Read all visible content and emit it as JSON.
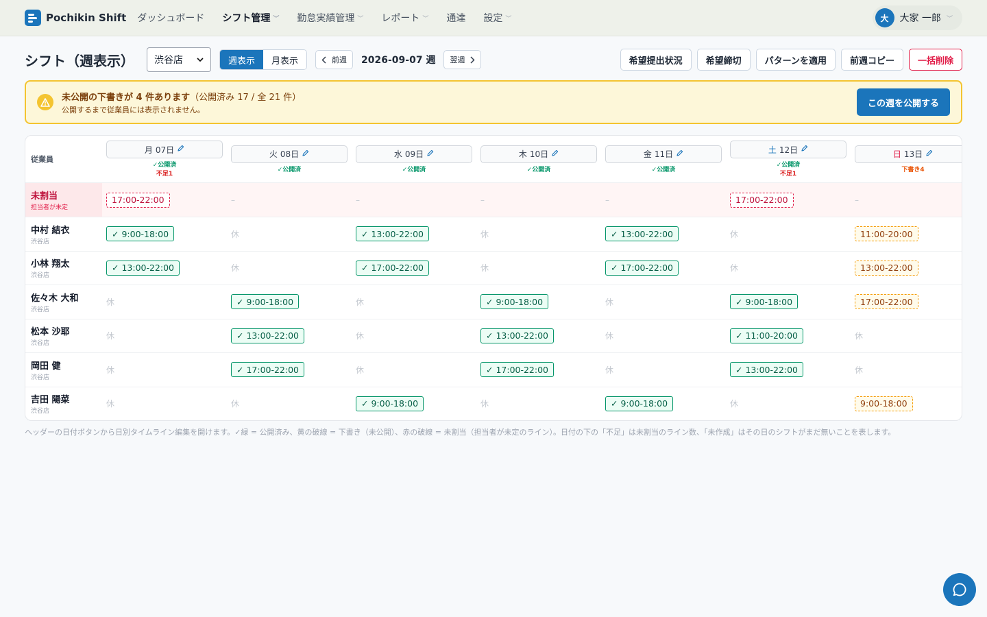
{
  "brand": {
    "name": "Pochikin Shift"
  },
  "nav": {
    "items": [
      {
        "label": "ダッシュボード",
        "dropdown": false
      },
      {
        "label": "シフト管理",
        "dropdown": true,
        "active": true
      },
      {
        "label": "勤怠実績管理",
        "dropdown": true
      },
      {
        "label": "レポート",
        "dropdown": true
      },
      {
        "label": "通達",
        "dropdown": false
      },
      {
        "label": "設定",
        "dropdown": true
      }
    ]
  },
  "user": {
    "initial": "大",
    "name": "大家 一郎"
  },
  "toolbar": {
    "title": "シフト（週表示）",
    "store": "渋谷店",
    "view_week": "週表示",
    "view_month": "月表示",
    "prev": "前週",
    "week_label": "2026-09-07 週",
    "next": "翌週",
    "actions": [
      "希望提出状況",
      "希望締切",
      "パターンを適用",
      "前週コピー",
      "一括削除"
    ]
  },
  "banner": {
    "headline": "未公開の下書きが 4 件あります",
    "counts": "（公開済み 17 / 全 21 件）",
    "note": "公開するまで従業員には表示されません。",
    "publish": "この週を公開する"
  },
  "table": {
    "employee_header": "従業員",
    "days": [
      {
        "weekday": "月",
        "date": "07日",
        "status": "✓公開済",
        "lack": "不足1",
        "kind": "weekday"
      },
      {
        "weekday": "火",
        "date": "08日",
        "status": "✓公開済",
        "lack": "",
        "kind": "weekday"
      },
      {
        "weekday": "水",
        "date": "09日",
        "status": "✓公開済",
        "lack": "",
        "kind": "weekday"
      },
      {
        "weekday": "木",
        "date": "10日",
        "status": "✓公開済",
        "lack": "",
        "kind": "weekday"
      },
      {
        "weekday": "金",
        "date": "11日",
        "status": "✓公開済",
        "lack": "",
        "kind": "weekday"
      },
      {
        "weekday": "土",
        "date": "12日",
        "status": "✓公開済",
        "lack": "不足1",
        "kind": "sat"
      },
      {
        "weekday": "日",
        "date": "13日",
        "status": "下書き4",
        "lack": "",
        "kind": "sun"
      }
    ],
    "unassigned": {
      "name": "未割当",
      "sub": "担当者が未定",
      "cells": [
        "17:00-22:00",
        "–",
        "–",
        "–",
        "–",
        "17:00-22:00",
        "–"
      ]
    },
    "employees": [
      {
        "name": "中村 結衣",
        "store": "渋谷店",
        "cells": [
          {
            "t": "pub",
            "v": "✓ 9:00-18:00"
          },
          {
            "t": "off",
            "v": "休"
          },
          {
            "t": "pub",
            "v": "✓ 13:00-22:00"
          },
          {
            "t": "off",
            "v": "休"
          },
          {
            "t": "pub",
            "v": "✓ 13:00-22:00"
          },
          {
            "t": "off",
            "v": "休"
          },
          {
            "t": "draft",
            "v": "11:00-20:00"
          }
        ]
      },
      {
        "name": "小林 翔太",
        "store": "渋谷店",
        "cells": [
          {
            "t": "pub",
            "v": "✓ 13:00-22:00"
          },
          {
            "t": "off",
            "v": "休"
          },
          {
            "t": "pub",
            "v": "✓ 17:00-22:00"
          },
          {
            "t": "off",
            "v": "休"
          },
          {
            "t": "pub",
            "v": "✓ 17:00-22:00"
          },
          {
            "t": "off",
            "v": "休"
          },
          {
            "t": "draft",
            "v": "13:00-22:00"
          }
        ]
      },
      {
        "name": "佐々木 大和",
        "store": "渋谷店",
        "cells": [
          {
            "t": "off",
            "v": "休"
          },
          {
            "t": "pub",
            "v": "✓ 9:00-18:00"
          },
          {
            "t": "off",
            "v": "休"
          },
          {
            "t": "pub",
            "v": "✓ 9:00-18:00"
          },
          {
            "t": "off",
            "v": "休"
          },
          {
            "t": "pub",
            "v": "✓ 9:00-18:00"
          },
          {
            "t": "draft",
            "v": "17:00-22:00"
          }
        ]
      },
      {
        "name": "松本 沙耶",
        "store": "渋谷店",
        "cells": [
          {
            "t": "off",
            "v": "休"
          },
          {
            "t": "pub",
            "v": "✓ 13:00-22:00"
          },
          {
            "t": "off",
            "v": "休"
          },
          {
            "t": "pub",
            "v": "✓ 13:00-22:00"
          },
          {
            "t": "off",
            "v": "休"
          },
          {
            "t": "pub",
            "v": "✓ 11:00-20:00"
          },
          {
            "t": "off",
            "v": "休"
          }
        ]
      },
      {
        "name": "岡田 健",
        "store": "渋谷店",
        "cells": [
          {
            "t": "off",
            "v": "休"
          },
          {
            "t": "pub",
            "v": "✓ 17:00-22:00"
          },
          {
            "t": "off",
            "v": "休"
          },
          {
            "t": "pub",
            "v": "✓ 17:00-22:00"
          },
          {
            "t": "off",
            "v": "休"
          },
          {
            "t": "pub",
            "v": "✓ 13:00-22:00"
          },
          {
            "t": "off",
            "v": "休"
          }
        ]
      },
      {
        "name": "吉田 陽菜",
        "store": "渋谷店",
        "cells": [
          {
            "t": "off",
            "v": "休"
          },
          {
            "t": "off",
            "v": "休"
          },
          {
            "t": "pub",
            "v": "✓ 9:00-18:00"
          },
          {
            "t": "off",
            "v": "休"
          },
          {
            "t": "pub",
            "v": "✓ 9:00-18:00"
          },
          {
            "t": "off",
            "v": "休"
          },
          {
            "t": "draft",
            "v": "9:00-18:00"
          }
        ]
      }
    ]
  },
  "footnote": "ヘッダーの日付ボタンから日別タイムライン編集を開けます。✓緑 = 公開済み、黄の破線 = 下書き（未公開）、赤の破線 = 未割当（担当者が未定のライン）。日付の下の「不足」は未割当のライン数、「未作成」はその日のシフトがまだ無いことを表します。",
  "icons": {
    "warning": "warning-triangle-icon",
    "chat": "chat-bubble-icon",
    "edit": "pencil-icon"
  },
  "colors": {
    "accent": "#1b75bb",
    "published": "#059669",
    "draft": "#f59e0b",
    "unassigned": "#e11d48"
  }
}
